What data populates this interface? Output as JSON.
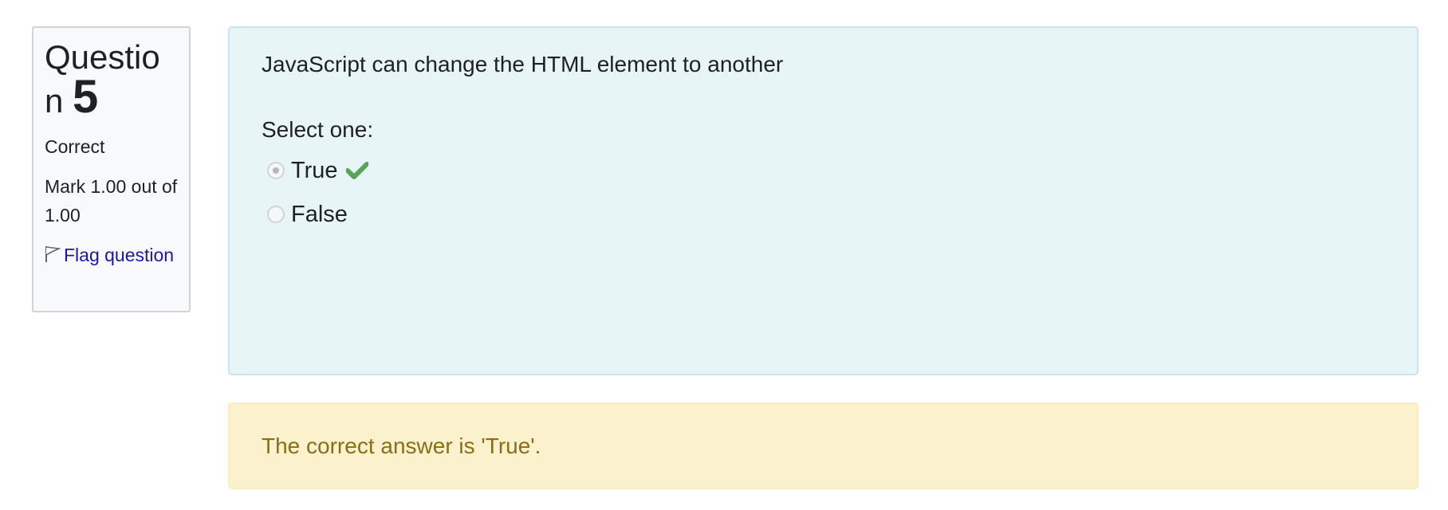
{
  "info": {
    "title_word": "Question",
    "number": "5",
    "state": "Correct",
    "grade": "Mark 1.00 out of 1.00",
    "flag_label": "Flag question"
  },
  "question": {
    "text": "JavaScript can change the HTML element to another",
    "prompt": "Select one:",
    "options": [
      {
        "label": "True",
        "selected": true,
        "correct": true
      },
      {
        "label": "False",
        "selected": false,
        "correct": false
      }
    ]
  },
  "feedback": {
    "right_answer": "The correct answer is 'True'."
  },
  "colors": {
    "correct_check": "#5aa457",
    "feedback_text": "#8a6d1a",
    "link": "#1a1a9c"
  },
  "icons": [
    "flag-icon",
    "check-icon"
  ]
}
